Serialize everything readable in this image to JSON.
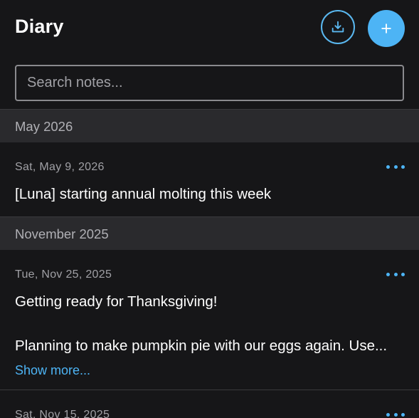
{
  "header": {
    "title": "Diary"
  },
  "search": {
    "placeholder": "Search notes..."
  },
  "accent_color": "#4db4f5",
  "sections": [
    {
      "label": "May 2026",
      "entries": [
        {
          "date": "Sat, May 9, 2026",
          "lines": [
            "[Luna] starting annual molting this week"
          ]
        }
      ]
    },
    {
      "label": "November 2025",
      "entries": [
        {
          "date": "Tue, Nov 25, 2025",
          "lines": [
            "Getting ready for Thanksgiving!",
            "Planning to make pumpkin pie with our eggs again. Use..."
          ],
          "show_more": "Show more..."
        },
        {
          "date": "Sat, Nov 15, 2025",
          "lines": []
        }
      ]
    }
  ]
}
